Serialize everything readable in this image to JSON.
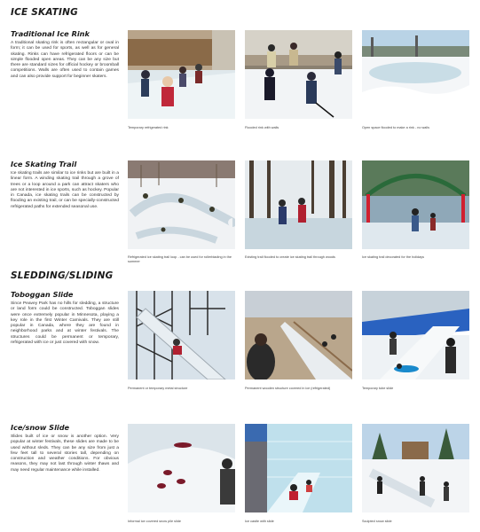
{
  "sections": {
    "ice_skating": "ICE SKATING",
    "sledding": "SLEDDING/SLIDING"
  },
  "rink": {
    "heading": "Traditional Ice Rink",
    "text": "A traditional skating rink is often rectangular or oval in form; it can be used for sports, as well as for general skating. Rinks can have refrigerated floors or can be simple flooded open areas. They can be any size but there are standard sizes for official hockey or broomball competitions. Walls are often used to contain games and can also provide support for beginner skaters.",
    "captions": [
      "Temporary refrigerated rink",
      "Flooded rink with walls",
      "Open space flooded to make a rink - no walls"
    ]
  },
  "trail": {
    "heading": "Ice Skating Trail",
    "text": "Ice skating trails are similar to ice rinks but are built in a linear form. A winding skating trail through a grove of trees or a loop around a park can attract skaters who are not interested in ice sports, such as hockey. Popular in Canada, ice skating trails can be constructed by flooding an existing trail, or can be specially-constructed refrigerated paths for extended seasonal use.",
    "captions": [
      "Refrigerated ice skating trail loop - can be used for rollerblading in the summer",
      "Existing trail flooded to create ice skating trail through woods",
      "Ice skating trail decorated for the holidays"
    ]
  },
  "toboggan": {
    "heading": "Toboggan Slide",
    "text": "Since Peavey Park has no hills for sledding, a structure or land form could be constructed. Toboggan slides were once extremely popular in Minnesota, playing a key role in the first Winter Carnivals. They are still popular in Canada, where they are found in neighborhood parks and at winter festivals. The structures could be permanent or temporary, refrigerated with ice or just covered with snow.",
    "captions": [
      "Permanent or temporary metal structure",
      "Permanent wooden structure covered in ice (refrigerated)",
      "Temporary tube slide"
    ]
  },
  "snowslide": {
    "heading": "Ice/snow Slide",
    "text": "Slides built of ice or snow is another option. Very popular at winter festivals, these slides are made to be used without sleds. They can be any size from just a few feet tall to several stories tall, depending on construction and weather conditions. For obvious reasons, they may not last through winter thaws and may need regular maintenance while installed.",
    "captions": [
      "Informal ice covered snow pile slide",
      "Ice castle with slide",
      "Sculpted snow slide"
    ]
  }
}
